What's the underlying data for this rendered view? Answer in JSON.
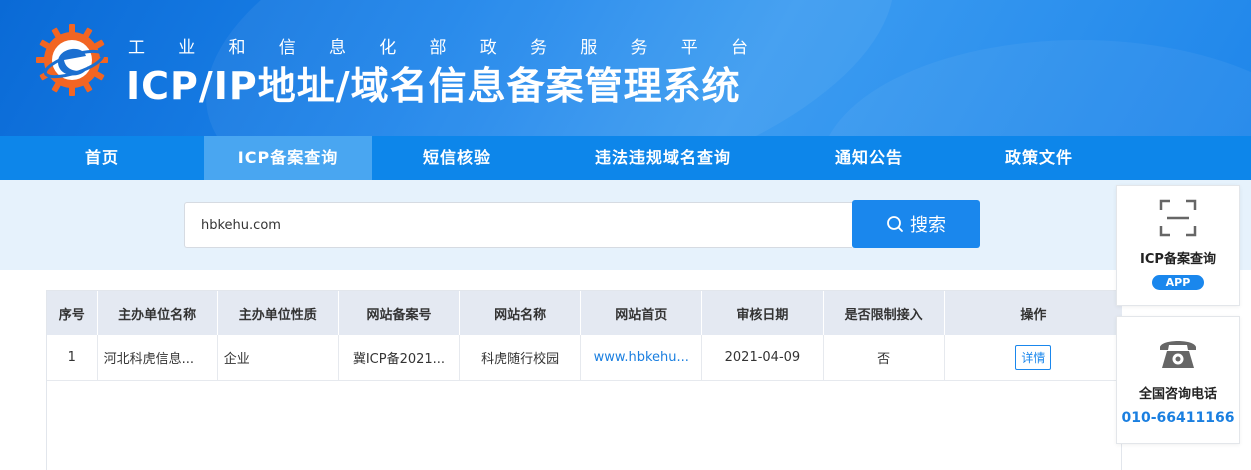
{
  "header": {
    "subtitle_chars": [
      "工",
      "业",
      "和",
      "信",
      "息",
      "化",
      "部",
      "政",
      "务",
      "服",
      "务",
      "平",
      "台"
    ],
    "title": "ICP/IP地址/域名信息备案管理系统",
    "logo_icon": "miit-logo-icon"
  },
  "nav": {
    "items": [
      {
        "label": "首页",
        "active": false
      },
      {
        "label": "ICP备案查询",
        "active": true
      },
      {
        "label": "短信核验",
        "active": false
      },
      {
        "label": "违法违规域名查询",
        "active": false
      },
      {
        "label": "通知公告",
        "active": false
      },
      {
        "label": "政策文件",
        "active": false
      }
    ]
  },
  "search": {
    "value": "hbkehu.com",
    "button_label": "搜索",
    "button_icon": "search-icon"
  },
  "table": {
    "headers": [
      "序号",
      "主办单位名称",
      "主办单位性质",
      "网站备案号",
      "网站名称",
      "网站首页",
      "审核日期",
      "是否限制接入",
      "操作"
    ],
    "rows": [
      {
        "index": "1",
        "org_name": "河北科虎信息...",
        "org_type": "企业",
        "record_no": "冀ICP备2021...",
        "site_name": "科虎随行校园",
        "homepage": "www.hbkehu...",
        "review_date": "2021-04-09",
        "restricted": "否",
        "action_label": "详情"
      }
    ]
  },
  "side": {
    "icp_card": {
      "label": "ICP备案查询",
      "badge": "APP",
      "icon": "scan-icon"
    },
    "phone_card": {
      "label": "全国咨询电话",
      "number": "010-66411166",
      "icon": "telephone-icon"
    }
  },
  "colors": {
    "primary": "#1a87ed",
    "nav_bg": "#0d86ea",
    "nav_active": "#49a6f1",
    "search_band": "#e6f2fc",
    "table_header": "#e4e9f2"
  }
}
